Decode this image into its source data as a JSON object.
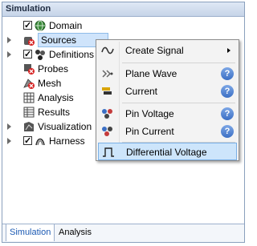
{
  "panel": {
    "title": "Simulation"
  },
  "tree": [
    {
      "label": "Domain",
      "icon": "globe-icon",
      "checked": true,
      "expander": false
    },
    {
      "label": "Sources",
      "icon": "sources-icon",
      "checked": false,
      "expander": true,
      "selected": true
    },
    {
      "label": "Definitions",
      "icon": "definitions-icon",
      "checked": true,
      "expander": true
    },
    {
      "label": "Probes",
      "icon": "probes-icon",
      "checked": false,
      "expander": false
    },
    {
      "label": "Mesh",
      "icon": "mesh-icon",
      "checked": false,
      "expander": false
    },
    {
      "label": "Analysis",
      "icon": "analysis-icon",
      "checked": false,
      "expander": false
    },
    {
      "label": "Results",
      "icon": "results-icon",
      "checked": false,
      "expander": false
    },
    {
      "label": "Visualization",
      "icon": "visualization-icon",
      "checked": false,
      "expander": true
    },
    {
      "label": "Harness",
      "icon": "harness-icon",
      "checked": true,
      "expander": true
    }
  ],
  "context_menu": {
    "items": [
      {
        "label": "Create Signal",
        "icon": "signal-wave-icon",
        "submenu": true
      },
      {
        "label": "Plane Wave",
        "icon": "plane-wave-icon",
        "help": "?"
      },
      {
        "label": "Current",
        "icon": "current-icon",
        "help": "?"
      },
      {
        "label": "Pin Voltage",
        "icon": "pin-voltage-icon",
        "help": "?"
      },
      {
        "label": "Pin Current",
        "icon": "pin-current-icon",
        "help": "?"
      },
      {
        "label": "Differential Voltage",
        "icon": "differential-voltage-icon",
        "highlighted": true
      }
    ]
  },
  "bottom_tabs": [
    "Simulation",
    "Analysis"
  ]
}
